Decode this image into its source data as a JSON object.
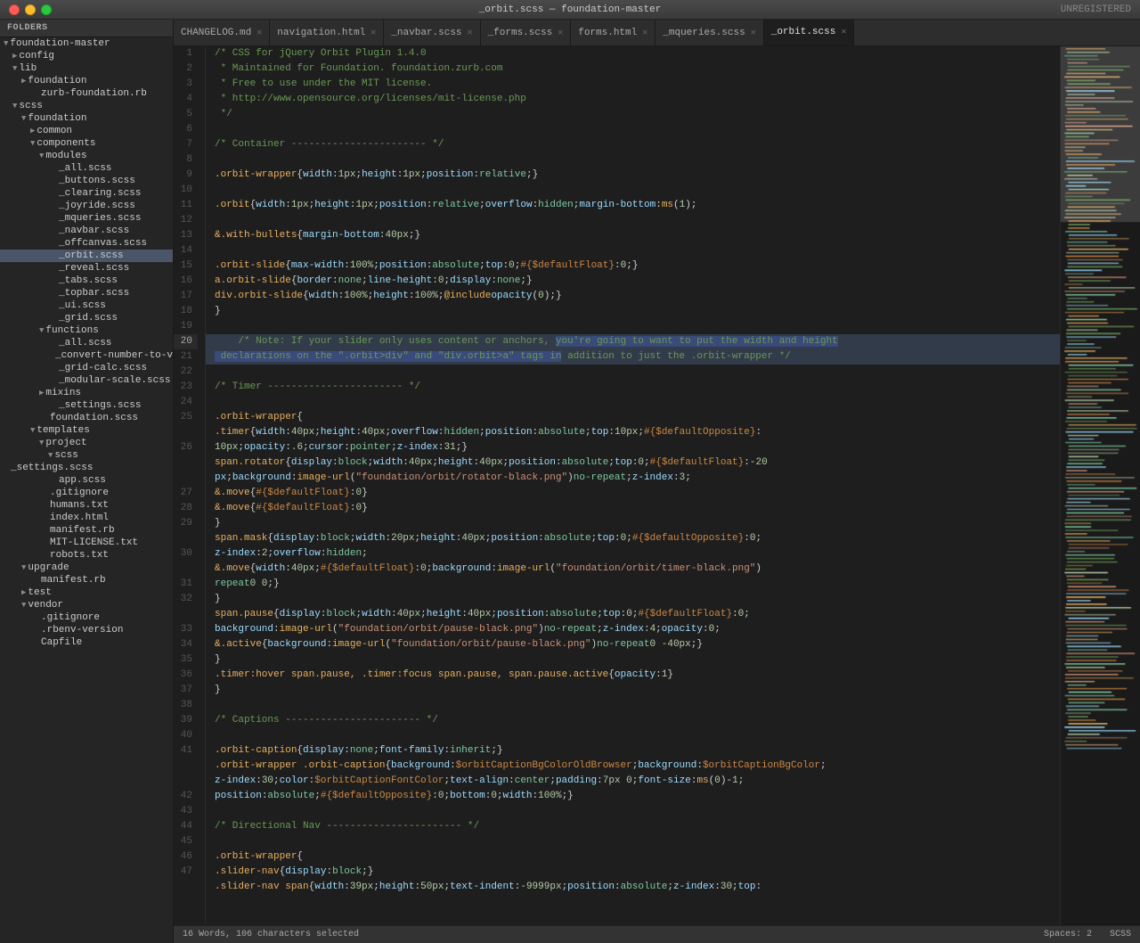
{
  "titlebar": {
    "title": "_orbit.scss — foundation-master",
    "unregistered": "UNREGISTERED"
  },
  "tabs": [
    {
      "id": "changelog",
      "label": "CHANGELOG.md",
      "active": false
    },
    {
      "id": "navigation",
      "label": "navigation.html",
      "active": false
    },
    {
      "id": "navbar-scss",
      "label": "_navbar.scss",
      "active": false
    },
    {
      "id": "forms-scss",
      "label": "_forms.scss",
      "active": false
    },
    {
      "id": "forms-html",
      "label": "forms.html",
      "active": false
    },
    {
      "id": "mqueries",
      "label": "_mqueries.scss",
      "active": false
    },
    {
      "id": "orbit",
      "label": "_orbit.scss",
      "active": true
    }
  ],
  "sidebar": {
    "header": "FOLDERS",
    "items": [
      {
        "level": 0,
        "label": "foundation-master",
        "arrow": "▼",
        "type": "folder-open"
      },
      {
        "level": 1,
        "label": "config",
        "arrow": "▶",
        "type": "folder"
      },
      {
        "level": 1,
        "label": "lib",
        "arrow": "▼",
        "type": "folder-open"
      },
      {
        "level": 2,
        "label": "foundation",
        "arrow": "▶",
        "type": "folder"
      },
      {
        "level": 3,
        "label": "zurb-foundation.rb",
        "type": "file"
      },
      {
        "level": 1,
        "label": "scss",
        "arrow": "▼",
        "type": "folder-open"
      },
      {
        "level": 2,
        "label": "foundation",
        "arrow": "▼",
        "type": "folder-open"
      },
      {
        "level": 3,
        "label": "common",
        "arrow": "▶",
        "type": "folder"
      },
      {
        "level": 3,
        "label": "components",
        "arrow": "▼",
        "type": "folder-open"
      },
      {
        "level": 4,
        "label": "modules",
        "arrow": "▼",
        "type": "folder-open"
      },
      {
        "level": 5,
        "label": "_all.scss",
        "type": "file"
      },
      {
        "level": 5,
        "label": "_buttons.scss",
        "type": "file"
      },
      {
        "level": 5,
        "label": "_clearing.scss",
        "type": "file"
      },
      {
        "level": 5,
        "label": "_joyride.scss",
        "type": "file"
      },
      {
        "level": 5,
        "label": "_mqueries.scss",
        "type": "file"
      },
      {
        "level": 5,
        "label": "_navbar.scss",
        "type": "file"
      },
      {
        "level": 5,
        "label": "_offcanvas.scss",
        "type": "file"
      },
      {
        "level": 5,
        "label": "_orbit.scss",
        "type": "file",
        "selected": true
      },
      {
        "level": 5,
        "label": "_reveal.scss",
        "type": "file"
      },
      {
        "level": 5,
        "label": "_tabs.scss",
        "type": "file"
      },
      {
        "level": 5,
        "label": "_topbar.scss",
        "type": "file"
      },
      {
        "level": 5,
        "label": "_ui.scss",
        "type": "file"
      },
      {
        "level": 5,
        "label": "_grid.scss",
        "type": "file"
      },
      {
        "level": 4,
        "label": "functions",
        "arrow": "▼",
        "type": "folder-open"
      },
      {
        "level": 5,
        "label": "_all.scss",
        "type": "file"
      },
      {
        "level": 5,
        "label": "_convert-number-to-v",
        "type": "file"
      },
      {
        "level": 5,
        "label": "_grid-calc.scss",
        "type": "file"
      },
      {
        "level": 5,
        "label": "_modular-scale.scss",
        "type": "file"
      },
      {
        "level": 4,
        "label": "mixins",
        "arrow": "▶",
        "type": "folder"
      },
      {
        "level": 5,
        "label": "_settings.scss",
        "type": "file"
      },
      {
        "level": 4,
        "label": "foundation.scss",
        "type": "file"
      },
      {
        "level": 3,
        "label": "templates",
        "arrow": "▼",
        "type": "folder-open"
      },
      {
        "level": 4,
        "label": "project",
        "arrow": "▼",
        "type": "folder-open"
      },
      {
        "level": 5,
        "label": "scss",
        "arrow": "▼",
        "type": "folder-open"
      },
      {
        "level": 6,
        "label": "_settings.scss",
        "type": "file"
      },
      {
        "level": 5,
        "label": "app.scss",
        "type": "file"
      },
      {
        "level": 4,
        "label": ".gitignore",
        "type": "file"
      },
      {
        "level": 4,
        "label": "humans.txt",
        "type": "file"
      },
      {
        "level": 4,
        "label": "index.html",
        "type": "file"
      },
      {
        "level": 4,
        "label": "manifest.rb",
        "type": "file"
      },
      {
        "level": 4,
        "label": "MIT-LICENSE.txt",
        "type": "file"
      },
      {
        "level": 4,
        "label": "robots.txt",
        "type": "file"
      },
      {
        "level": 2,
        "label": "upgrade",
        "arrow": "▼",
        "type": "folder-open"
      },
      {
        "level": 3,
        "label": "manifest.rb",
        "type": "file"
      },
      {
        "level": 2,
        "label": "test",
        "arrow": "▶",
        "type": "folder"
      },
      {
        "level": 2,
        "label": "vendor",
        "arrow": "▼",
        "type": "folder-open"
      },
      {
        "level": 3,
        "label": ".gitignore",
        "type": "file"
      },
      {
        "level": 3,
        "label": ".rbenv-version",
        "type": "file"
      },
      {
        "level": 3,
        "label": "Capfile",
        "type": "file"
      }
    ]
  },
  "statusbar": {
    "left": "16 Words, 106 characters selected",
    "right": "Spaces: 2",
    "lang": "SCSS"
  },
  "lines": [
    {
      "num": 1,
      "content": "/* CSS for jQuery Orbit Plugin 1.4.0",
      "type": "comment"
    },
    {
      "num": 2,
      "content": " * Maintained for Foundation. foundation.zurb.com",
      "type": "comment"
    },
    {
      "num": 3,
      "content": " * Free to use under the MIT license.",
      "type": "comment"
    },
    {
      "num": 4,
      "content": " * http://www.opensource.org/licenses/mit-license.php",
      "type": "comment"
    },
    {
      "num": 5,
      "content": " */",
      "type": "comment"
    },
    {
      "num": 6,
      "content": "",
      "type": "empty"
    },
    {
      "num": 7,
      "content": "    /* Container ----------------------- */",
      "type": "comment"
    },
    {
      "num": 8,
      "content": "",
      "type": "empty"
    },
    {
      "num": 9,
      "content": "    .orbit-wrapper { width: 1px; height: 1px; position: relative; }",
      "type": "code"
    },
    {
      "num": 10,
      "content": "",
      "type": "empty"
    },
    {
      "num": 11,
      "content": "    .orbit { width: 1px; height: 1px; position: relative; overflow: hidden; margin-bottom: ms(1);",
      "type": "code"
    },
    {
      "num": 12,
      "content": "",
      "type": "empty"
    },
    {
      "num": 13,
      "content": "      &.with-bullets { margin-bottom: 40px; }",
      "type": "code"
    },
    {
      "num": 14,
      "content": "",
      "type": "empty"
    },
    {
      "num": 15,
      "content": "      .orbit-slide { max-width: 100%; position: absolute; top: 0; #{$defaultFloat}: 0; }",
      "type": "code"
    },
    {
      "num": 16,
      "content": "      a.orbit-slide { border: none; line-height: 0; display: none; }",
      "type": "code"
    },
    {
      "num": 17,
      "content": "      div.orbit-slide { width: 100%; height: 100%; @include opacity(0); }",
      "type": "code"
    },
    {
      "num": 18,
      "content": "    }",
      "type": "code"
    },
    {
      "num": 19,
      "content": "",
      "type": "empty"
    },
    {
      "num": 20,
      "content": "    /* Note: If your slider only uses content or anchors, you're going to want to put the width and height declarations on the \".orbit>div\" and \"div.orbit>a\" tags in addition to just the .orbit-wrapper */",
      "type": "comment-selected"
    },
    {
      "num": 21,
      "content": "",
      "type": "empty"
    },
    {
      "num": 22,
      "content": "    /* Timer ----------------------- */",
      "type": "comment"
    },
    {
      "num": 23,
      "content": "",
      "type": "empty"
    },
    {
      "num": 24,
      "content": "    .orbit-wrapper {",
      "type": "code"
    },
    {
      "num": 25,
      "content": "      .timer { width: 40px; height: 40px; overflow: hidden; position: absolute; top: 10px; #{$defaultOpposite}:",
      "type": "code"
    },
    {
      "num": 25,
      "content": "        10px; opacity: .6; cursor: pointer; z-index: 31; }",
      "type": "code-cont"
    },
    {
      "num": 26,
      "content": "      span.rotator { display: block; width: 40px; height: 40px; position: absolute; top: 0; #{$defaultFloat}: -20",
      "type": "code"
    },
    {
      "num": 26,
      "content": "        px; background: image-url(\"foundation/orbit/rotator-black.png\") no-repeat; z-index: 3;",
      "type": "code-cont"
    },
    {
      "num": 27,
      "content": "        &.move { #{$defaultFloat}: 0 }",
      "type": "code-cont"
    },
    {
      "num": 28,
      "content": "      }",
      "type": "code"
    },
    {
      "num": 29,
      "content": "      span.mask { display: block; width: 20px; height: 40px; position: absolute; top: 0; #{$defaultOpposite}: 0;",
      "type": "code"
    },
    {
      "num": 29,
      "content": "        z-index: 2; overflow: hidden;",
      "type": "code-cont"
    },
    {
      "num": 30,
      "content": "        &.move { width: 40px; #{$defaultFloat}: 0; background: image-url(\"foundation/orbit/timer-black.png\")",
      "type": "code"
    },
    {
      "num": 30,
      "content": "          repeat 0 0; }",
      "type": "code-cont"
    },
    {
      "num": 31,
      "content": "      }",
      "type": "code"
    },
    {
      "num": 32,
      "content": "      span.pause { display: block; width: 40px; height: 40px; position: absolute; top: 0; #{$defaultFloat}: 0;",
      "type": "code"
    },
    {
      "num": 32,
      "content": "          background: image-url(\"foundation/orbit/pause-black.png\") no-repeat; z-index: 4; opacity: 0;",
      "type": "code-cont"
    },
    {
      "num": 33,
      "content": "        &.active { background: image-url(\"foundation/orbit/pause-black.png\") no-repeat 0 -40px; }",
      "type": "code-cont"
    },
    {
      "num": 34,
      "content": "      }",
      "type": "code"
    },
    {
      "num": 35,
      "content": "      .timer:hover span.pause, .timer:focus span.pause, span.pause.active { opacity: 1 }",
      "type": "code"
    },
    {
      "num": 36,
      "content": "    }",
      "type": "code"
    },
    {
      "num": 37,
      "content": "",
      "type": "empty"
    },
    {
      "num": 38,
      "content": "    /* Captions ----------------------- */",
      "type": "comment"
    },
    {
      "num": 39,
      "content": "",
      "type": "empty"
    },
    {
      "num": 40,
      "content": "    .orbit-caption { display: none; font-family: inherit; }",
      "type": "code"
    },
    {
      "num": 41,
      "content": "    .orbit-wrapper .orbit-caption { background: $orbitCaptionBgColorOldBrowser; background: $orbitCaptionBgColor;",
      "type": "code"
    },
    {
      "num": 41,
      "content": "        z-index: 30; color: $orbitCaptionFontColor; text-align: center; padding: 7px 0; font-size: ms(0) - 1;",
      "type": "code-cont"
    },
    {
      "num": 41,
      "content": "        position: absolute; #{$defaultOpposite}: 0; bottom: 0; width: 100%; }",
      "type": "code-cont"
    },
    {
      "num": 42,
      "content": "",
      "type": "empty"
    },
    {
      "num": 43,
      "content": "    /* Directional Nav ----------------------- */",
      "type": "comment"
    },
    {
      "num": 44,
      "content": "",
      "type": "empty"
    },
    {
      "num": 45,
      "content": "    .orbit-wrapper {",
      "type": "code"
    },
    {
      "num": 46,
      "content": "      .slider-nav { display: block; }",
      "type": "code"
    },
    {
      "num": 47,
      "content": "      .slider-nav span { width: 39px; height: 50px; text-indent: -9999px; position: absolute; z-index: 30; top:",
      "type": "code"
    }
  ]
}
